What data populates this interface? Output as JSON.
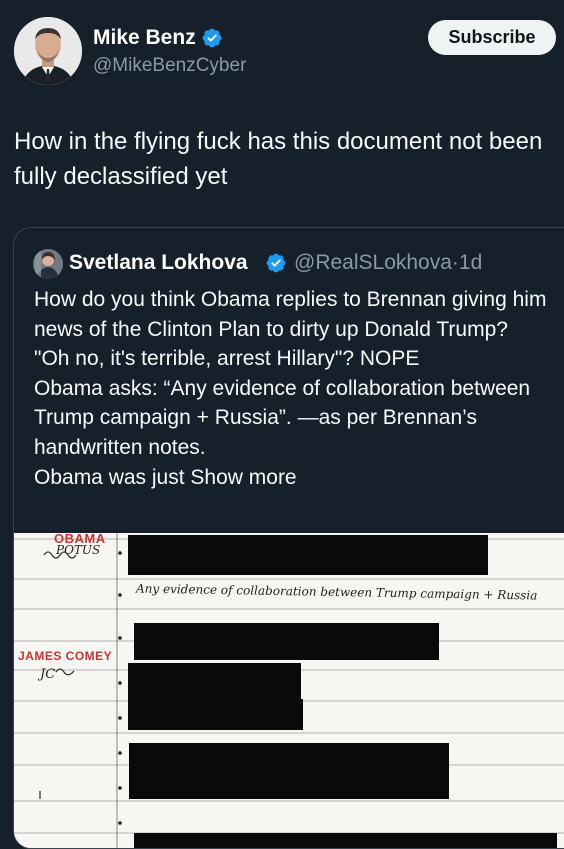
{
  "author": {
    "name": "Mike Benz",
    "handle": "@MikeBenzCyber",
    "subscribe_label": "Subscribe"
  },
  "tweet": {
    "text": "How in the flying fuck has this document not been fully declassified yet"
  },
  "quoted": {
    "name": "Svetlana Lokhova",
    "handle": "@RealSLokhova",
    "separator": "·",
    "time": "1d",
    "text": "How do you think Obama replies to Brennan giving him news of the Clinton Plan to dirty up Donald Trump?\n\"Oh no, it's terrible, arrest Hillary\"? NOPE\nObama asks: “Any evidence of collaboration between Trump campaign + Russia”. —as per Brennan’s handwritten notes.\nObama was just ",
    "show_more": "Show more"
  },
  "document": {
    "label_obama": "OBAMA",
    "hand_potus": "POTUS",
    "label_comey": "JAMES COMEY",
    "hand_jc": "JC",
    "handwritten_note": "Any evidence of collaboration between Trump campaign + Russia"
  },
  "colors": {
    "background": "#15202b",
    "verified": "#1d9bf0",
    "secondary_text": "#8b98a5",
    "border": "#38444d",
    "redaction": "#0a0a0a",
    "annotation_red": "#cc3333"
  }
}
